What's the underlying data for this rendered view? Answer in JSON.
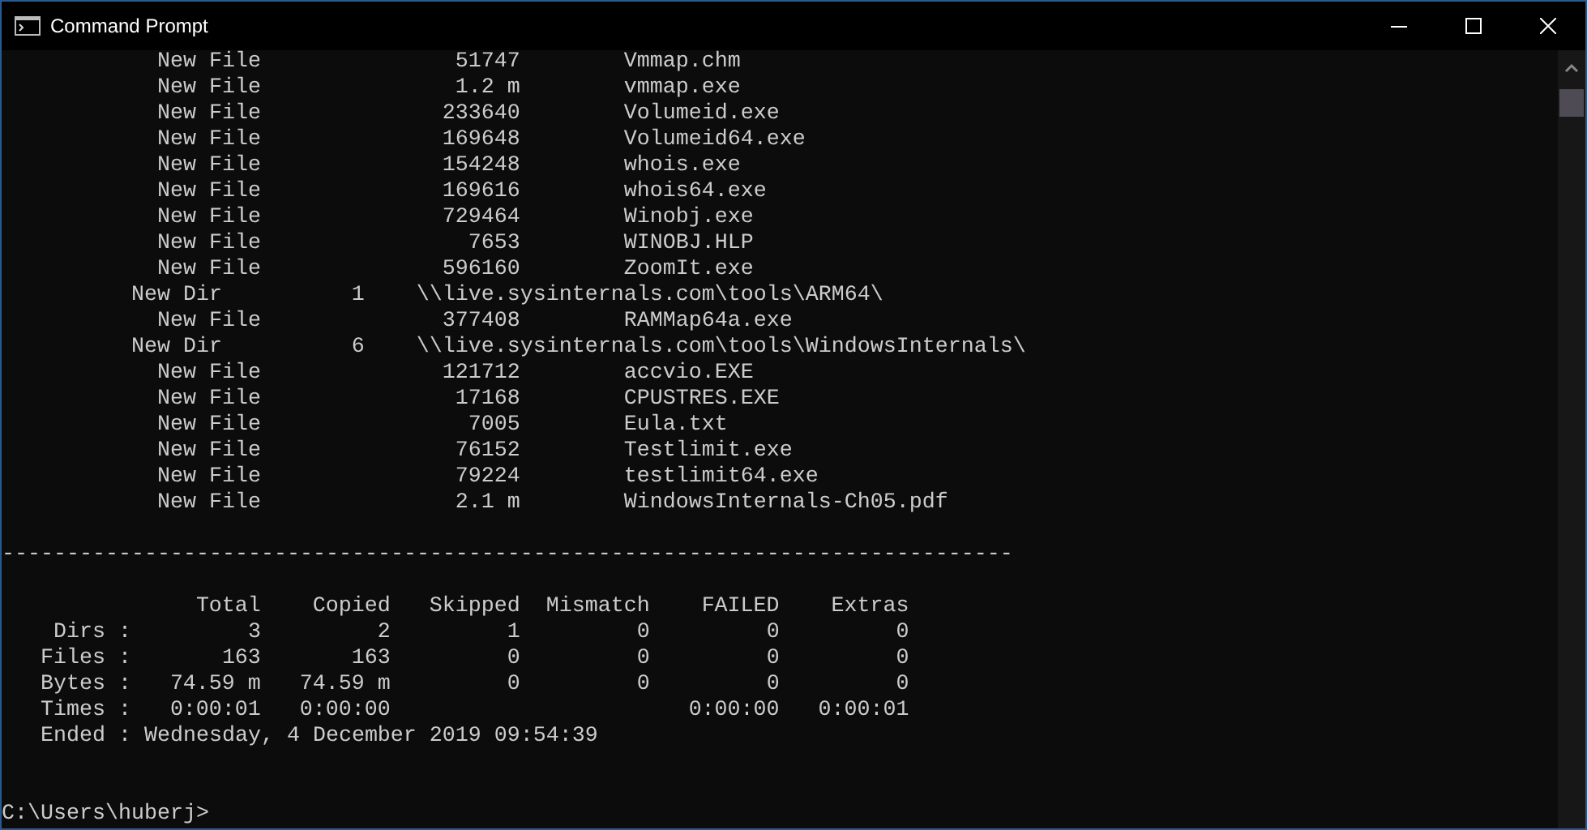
{
  "window": {
    "title": "Command Prompt"
  },
  "console": {
    "rows": [
      {
        "kind": "file",
        "type": "New File",
        "size": "51747",
        "name": "Vmmap.chm"
      },
      {
        "kind": "file",
        "type": "New File",
        "size": "1.2 m",
        "name": "vmmap.exe"
      },
      {
        "kind": "file",
        "type": "New File",
        "size": "233640",
        "name": "Volumeid.exe"
      },
      {
        "kind": "file",
        "type": "New File",
        "size": "169648",
        "name": "Volumeid64.exe"
      },
      {
        "kind": "file",
        "type": "New File",
        "size": "154248",
        "name": "whois.exe"
      },
      {
        "kind": "file",
        "type": "New File",
        "size": "169616",
        "name": "whois64.exe"
      },
      {
        "kind": "file",
        "type": "New File",
        "size": "729464",
        "name": "Winobj.exe"
      },
      {
        "kind": "file",
        "type": "New File",
        "size": "7653",
        "name": "WINOBJ.HLP"
      },
      {
        "kind": "file",
        "type": "New File",
        "size": "596160",
        "name": "ZoomIt.exe"
      },
      {
        "kind": "dir",
        "type": "New Dir",
        "size": "1",
        "name": "\\\\live.sysinternals.com\\tools\\ARM64\\"
      },
      {
        "kind": "file",
        "type": "New File",
        "size": "377408",
        "name": "RAMMap64a.exe"
      },
      {
        "kind": "dir",
        "type": "New Dir",
        "size": "6",
        "name": "\\\\live.sysinternals.com\\tools\\WindowsInternals\\"
      },
      {
        "kind": "file",
        "type": "New File",
        "size": "121712",
        "name": "accvio.EXE"
      },
      {
        "kind": "file",
        "type": "New File",
        "size": "17168",
        "name": "CPUSTRES.EXE"
      },
      {
        "kind": "file",
        "type": "New File",
        "size": "7005",
        "name": "Eula.txt"
      },
      {
        "kind": "file",
        "type": "New File",
        "size": "76152",
        "name": "Testlimit.exe"
      },
      {
        "kind": "file",
        "type": "New File",
        "size": "79224",
        "name": "testlimit64.exe"
      },
      {
        "kind": "file",
        "type": "New File",
        "size": "2.1 m",
        "name": "WindowsInternals-Ch05.pdf"
      }
    ],
    "separator": "------------------------------------------------------------------------------",
    "summary": {
      "columns": [
        "Total",
        "Copied",
        "Skipped",
        "Mismatch",
        "FAILED",
        "Extras"
      ],
      "rows": [
        {
          "label": "Dirs :",
          "values": {
            "total": "3",
            "copied": "2",
            "skipped": "1",
            "mismatch": "0",
            "failed": "0",
            "extras": "0"
          }
        },
        {
          "label": "Files :",
          "values": {
            "total": "163",
            "copied": "163",
            "skipped": "0",
            "mismatch": "0",
            "failed": "0",
            "extras": "0"
          }
        },
        {
          "label": "Bytes :",
          "values": {
            "total": "74.59 m",
            "copied": "74.59 m",
            "skipped": "0",
            "mismatch": "0",
            "failed": "0",
            "extras": "0"
          }
        },
        {
          "label": "Times :",
          "values": {
            "total": "0:00:01",
            "copied": "0:00:00",
            "failed": "0:00:00",
            "extras": "0:00:01"
          }
        }
      ],
      "ended": {
        "label": "Ended :",
        "value": "Wednesday, 4 December 2019 09:54:39"
      }
    },
    "prompt": "C:\\Users\\huberj>"
  }
}
